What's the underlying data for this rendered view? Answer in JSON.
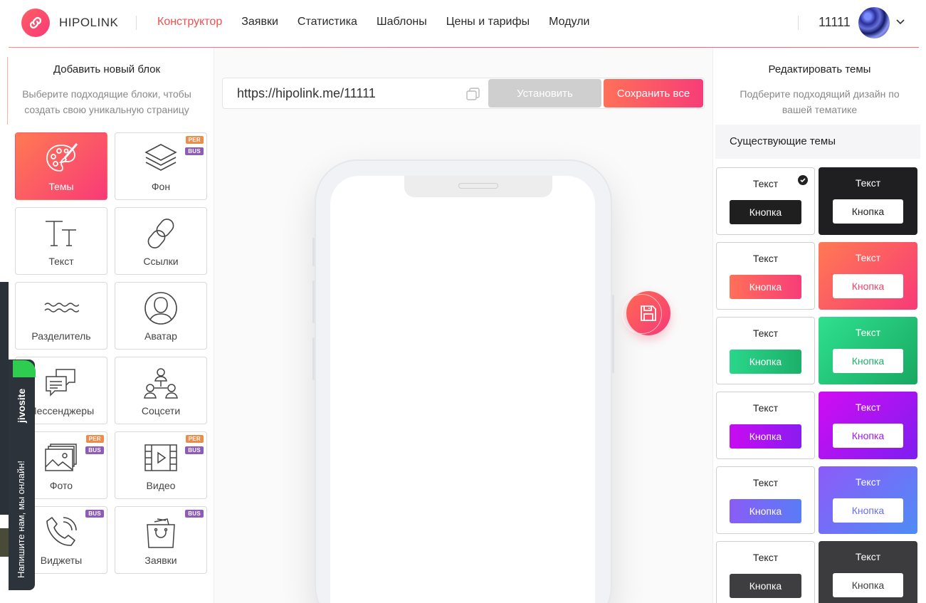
{
  "header": {
    "logo": "HIPOLINK",
    "nav": [
      {
        "label": "Конструктор",
        "active": true
      },
      {
        "label": "Заявки",
        "active": false
      },
      {
        "label": "Статистика",
        "active": false
      },
      {
        "label": "Шаблоны",
        "active": false
      },
      {
        "label": "Цены и тарифы",
        "active": false
      },
      {
        "label": "Модули",
        "active": false
      }
    ],
    "account": "11111"
  },
  "left_panel": {
    "title": "Добавить новый блок",
    "subtitle": "Выберите подходящие блоки, чтобы создать свою уникальную страницу",
    "blocks": [
      {
        "label": "Темы",
        "icon": "palette-icon",
        "active": true,
        "tags": []
      },
      {
        "label": "Фон",
        "icon": "layers-icon",
        "active": false,
        "tags": [
          "PER",
          "BUS"
        ]
      },
      {
        "label": "Текст",
        "icon": "text-tt-icon",
        "active": false,
        "tags": []
      },
      {
        "label": "Ссылки",
        "icon": "link-icon",
        "active": false,
        "tags": []
      },
      {
        "label": "Разделитель",
        "icon": "wave-divider-icon",
        "active": false,
        "tags": []
      },
      {
        "label": "Аватар",
        "icon": "user-avatar-icon",
        "active": false,
        "tags": []
      },
      {
        "label": "Мессенджеры",
        "icon": "chat-bubbles-icon",
        "active": false,
        "tags": []
      },
      {
        "label": "Соцсети",
        "icon": "social-network-icon",
        "active": false,
        "tags": []
      },
      {
        "label": "Фото",
        "icon": "photo-stack-icon",
        "active": false,
        "tags": [
          "PER",
          "BUS"
        ]
      },
      {
        "label": "Видео",
        "icon": "video-film-icon",
        "active": false,
        "tags": [
          "PER",
          "BUS"
        ]
      },
      {
        "label": "Виджеты",
        "icon": "phone-call-icon",
        "active": false,
        "tags": [
          "BUS"
        ]
      },
      {
        "label": "Заявки",
        "icon": "shopping-bag-icon",
        "active": false,
        "tags": [
          "BUS"
        ]
      }
    ]
  },
  "editor": {
    "url": "https://hipolink.me/11111",
    "install_label": "Установить",
    "save_all_label": "Сохранить все"
  },
  "jivo": {
    "brand": "jivosite",
    "text": "Напишите нам, мы онлайн!"
  },
  "right_panel": {
    "title": "Редактировать темы",
    "subtitle": "Подберите подходящий дизайн по вашей тематике",
    "existing_label": "Существующие темы",
    "themes": [
      {
        "text": "Текст",
        "button": "Кнопка",
        "bg": "#ffffff",
        "text_color": "#222222",
        "btn_bg": "#1f1f1f",
        "btn_color": "#ffffff",
        "selected": true
      },
      {
        "text": "Текст",
        "button": "Кнопка",
        "bg": "#1f1f21",
        "text_color": "#ffffff",
        "btn_bg": "#ffffff",
        "btn_color": "#222222",
        "selected": false
      },
      {
        "text": "Текст",
        "button": "Кнопка",
        "bg": "#ffffff",
        "text_color": "#222222",
        "btn_bg": "linear-gradient(90deg,#ff7058,#f73d78)",
        "btn_color": "#ffffff",
        "selected": false
      },
      {
        "text": "Текст",
        "button": "Кнопка",
        "bg": "linear-gradient(135deg,#ff7a52,#f83a78)",
        "text_color": "#ffffff",
        "btn_bg": "#ffffff",
        "btn_color": "#f0446a",
        "selected": false
      },
      {
        "text": "Текст",
        "button": "Кнопка",
        "bg": "#ffffff",
        "text_color": "#222222",
        "btn_bg": "linear-gradient(90deg,#2ad68a,#1cb06a)",
        "btn_color": "#ffffff",
        "selected": false
      },
      {
        "text": "Текст",
        "button": "Кнопка",
        "bg": "linear-gradient(135deg,#2fe08f,#18a862)",
        "text_color": "#ffffff",
        "btn_bg": "#ffffff",
        "btn_color": "#1cb06a",
        "selected": false
      },
      {
        "text": "Текст",
        "button": "Кнопка",
        "bg": "#ffffff",
        "text_color": "#222222",
        "btn_bg": "linear-gradient(90deg,#c80cf0,#8a1cf0)",
        "btn_color": "#ffffff",
        "selected": false
      },
      {
        "text": "Текст",
        "button": "Кнопка",
        "bg": "linear-gradient(135deg,#d20cf2,#7e1ef0)",
        "text_color": "#ffffff",
        "btn_bg": "#ffffff",
        "btn_color": "#a216f0",
        "selected": false
      },
      {
        "text": "Текст",
        "button": "Кнопка",
        "bg": "#ffffff",
        "text_color": "#222222",
        "btn_bg": "linear-gradient(90deg,#8a5cf6,#5a7cf6)",
        "btn_color": "#ffffff",
        "selected": false
      },
      {
        "text": "Текст",
        "button": "Кнопка",
        "bg": "linear-gradient(135deg,#8e5af8,#4e8cf6)",
        "text_color": "#ffffff",
        "btn_bg": "#ffffff",
        "btn_color": "#6a6cf6",
        "selected": false
      },
      {
        "text": "Текст",
        "button": "Кнопка",
        "bg": "#ffffff",
        "text_color": "#222222",
        "btn_bg": "#3e3e40",
        "btn_color": "#ffffff",
        "selected": false
      },
      {
        "text": "Текст",
        "button": "Кнопка",
        "bg": "#3c3c3e",
        "text_color": "#ffffff",
        "btn_bg": "#ffffff",
        "btn_color": "#3c3c3e",
        "selected": false
      }
    ]
  }
}
